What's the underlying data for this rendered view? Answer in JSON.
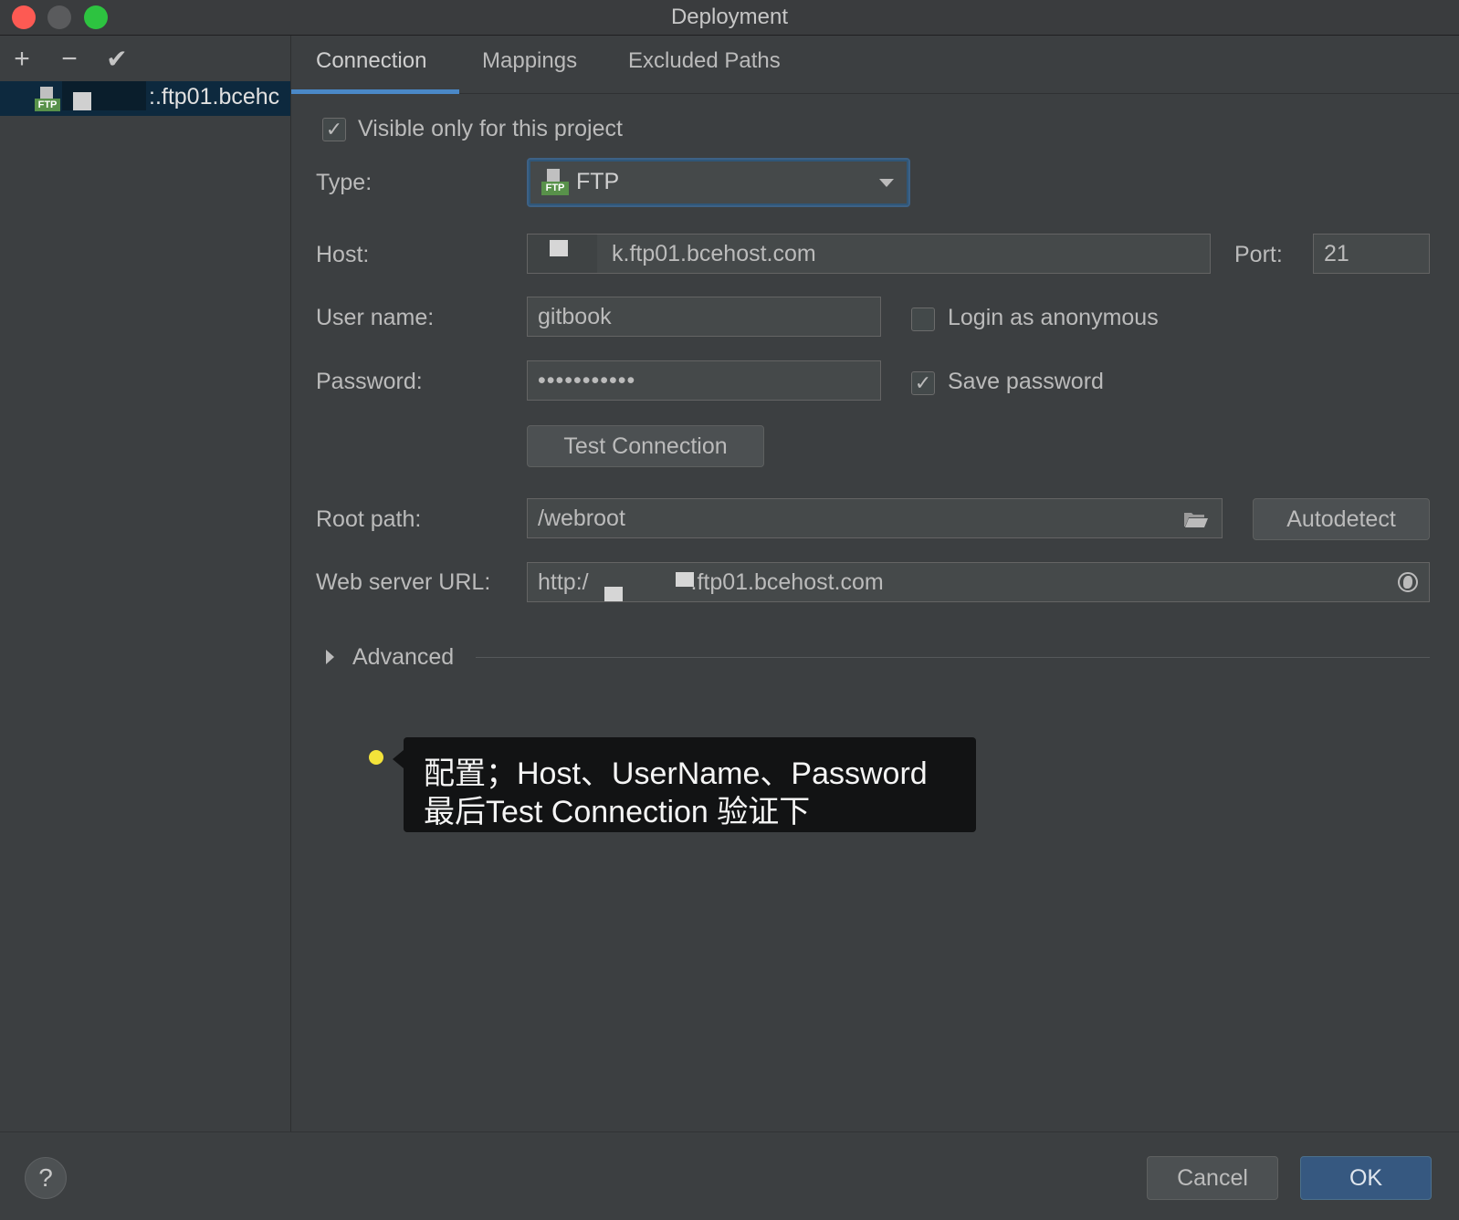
{
  "window": {
    "title": "Deployment"
  },
  "sidebar": {
    "toolbar": {
      "add": "+",
      "remove": "−",
      "apply": "✔"
    },
    "servers": [
      {
        "label": ":.ftp01.bcehc",
        "type_badge": "FTP"
      }
    ]
  },
  "tabs": [
    {
      "label": "Connection",
      "active": true
    },
    {
      "label": "Mappings",
      "active": false
    },
    {
      "label": "Excluded Paths",
      "active": false
    }
  ],
  "form": {
    "visible_only": {
      "label": "Visible only for this project",
      "checked": true
    },
    "type": {
      "label": "Type:",
      "value": "FTP",
      "badge": "FTP"
    },
    "host": {
      "label": "Host:",
      "value": "k.ftp01.bcehost.com"
    },
    "port": {
      "label": "Port:",
      "value": "21"
    },
    "username": {
      "label": "User name:",
      "value": "gitbook"
    },
    "anonymous": {
      "label": "Login as anonymous",
      "checked": false
    },
    "password": {
      "label": "Password:",
      "value": "•••••••••••"
    },
    "save_password": {
      "label": "Save password",
      "checked": true
    },
    "test_connection": "Test Connection",
    "root_path": {
      "label": "Root path:",
      "value": "/webroot"
    },
    "autodetect": "Autodetect",
    "web_url": {
      "label": "Web server URL:",
      "prefix": "http:/",
      "suffix": ".ftp01.bcehost.com"
    },
    "advanced": "Advanced"
  },
  "annotation": {
    "line1": "配置；Host、UserName、Password",
    "line2": "最后Test Connection 验证下"
  },
  "footer": {
    "help": "?",
    "cancel": "Cancel",
    "ok": "OK"
  },
  "colors": {
    "accent": "#4a88c7",
    "ok_button": "#365880",
    "annotation_dot": "#f3e33a",
    "ftp_badge": "#58914a"
  }
}
